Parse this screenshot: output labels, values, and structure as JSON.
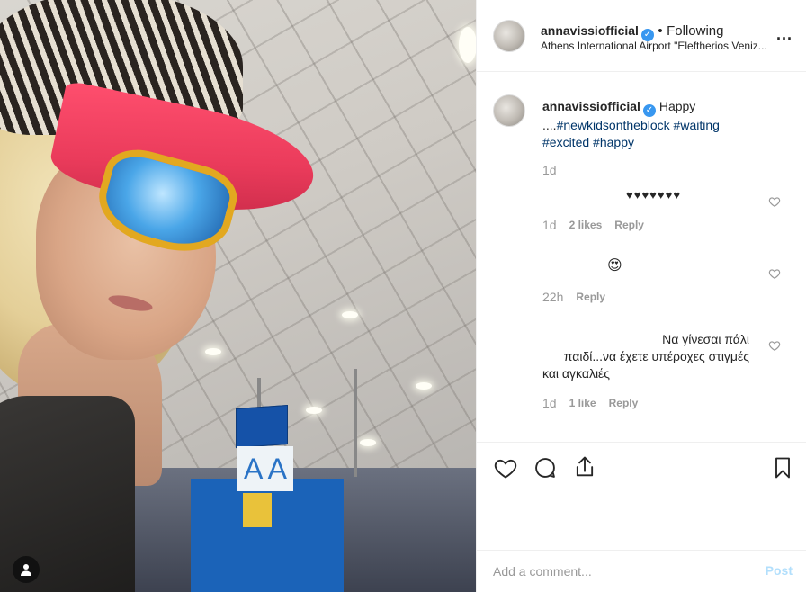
{
  "post": {
    "username": "annavissiofficial",
    "follow_separator": "•",
    "follow_label": "Following",
    "location": "Athens International Airport \"Eleftherios Veniz...",
    "more_label": "..."
  },
  "caption": {
    "username": "annavissiofficial",
    "text": "Happy",
    "prefix": "....",
    "hashtags_line1": "#newkidsontheblock",
    "hashtags_line1b": "#waiting",
    "hashtags_line2a": "#excited",
    "hashtags_line2b": "#happy",
    "time": "1d"
  },
  "comments": [
    {
      "text": "♥♥♥♥♥♥♥",
      "time": "1d",
      "likes": "2 likes",
      "reply": "Reply"
    },
    {
      "text": "😍",
      "time": "22h",
      "likes": "",
      "reply": "Reply"
    },
    {
      "text_line1": "Να γίνεσαι πάλι",
      "text_line2": "παιδί...να έχετε υπέροχες στιγμές",
      "text_line3": "και αγκαλιές",
      "time": "1d",
      "likes": "1 like",
      "reply": "Reply"
    }
  ],
  "add_comment": {
    "placeholder": "Add a comment...",
    "post_label": "Post"
  },
  "photo": {
    "sign_text": "A A"
  },
  "colors": {
    "accent": "#3897f0",
    "hashtag": "#003569",
    "post_disabled": "#b2dffc"
  }
}
